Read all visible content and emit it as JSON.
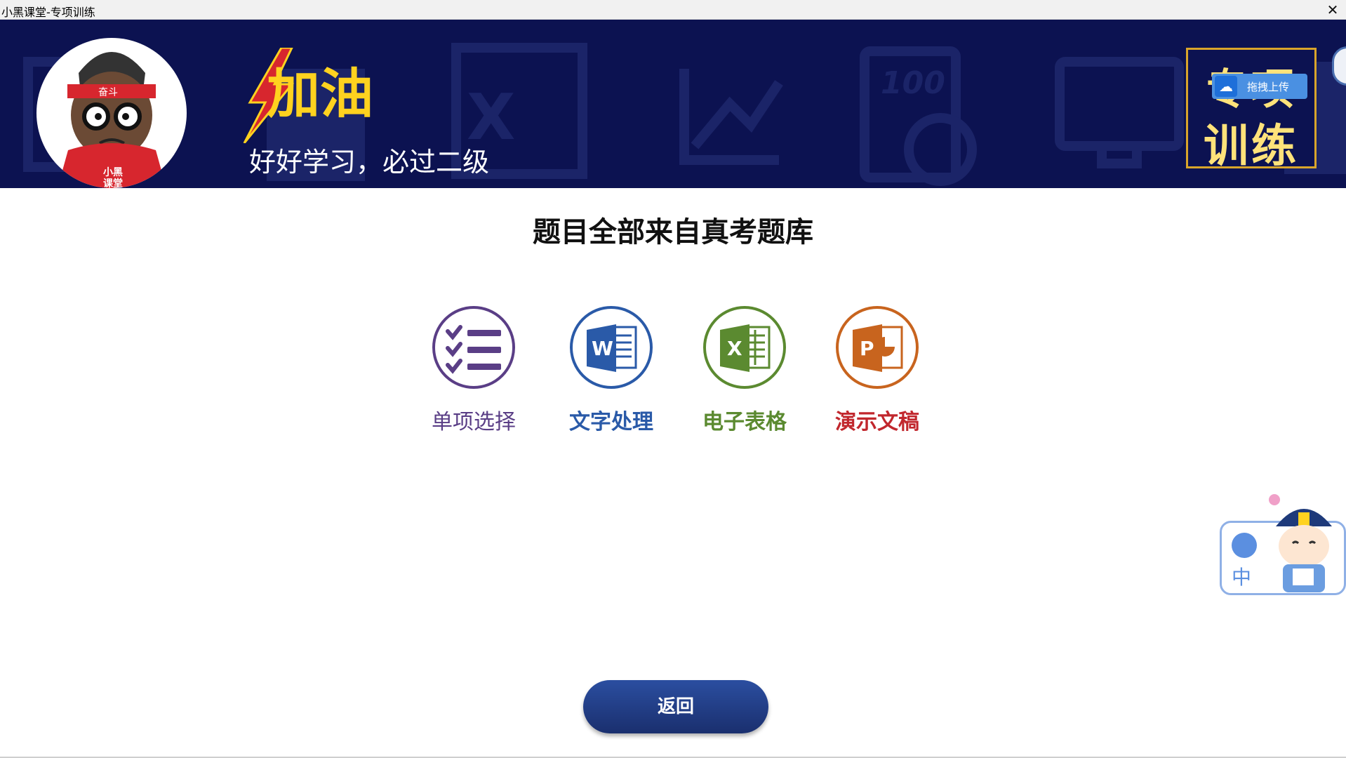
{
  "window": {
    "title": "小黑课堂-专项训练",
    "close_label": "✕"
  },
  "banner": {
    "cheer_text": "加油",
    "slogan": "好好学习，必过二级",
    "badge_line1": "专项",
    "badge_line2": "训练",
    "avatar_shirt_text": "小黑\n课堂",
    "headband_text": "奋斗"
  },
  "upload_widget": {
    "label": "拖拽上传",
    "icon": "cloud-icon"
  },
  "main": {
    "heading": "题目全部来自真考题库",
    "categories": [
      {
        "label": "单项选择",
        "icon": "checklist-icon",
        "color": "#5a3e86"
      },
      {
        "label": "文字处理",
        "icon": "word-icon",
        "color": "#2a5aa8"
      },
      {
        "label": "电子表格",
        "icon": "excel-icon",
        "color": "#5b8a30"
      },
      {
        "label": "演示文稿",
        "icon": "powerpoint-icon",
        "color": "#c1272d"
      }
    ],
    "return_label": "返回"
  },
  "ime": {
    "mode_label": "中",
    "icon": "tshirt-icon"
  },
  "colors": {
    "banner_bg": "#0c1251",
    "accent_gold": "#d9a52b",
    "return_button": "#1f3a80"
  }
}
